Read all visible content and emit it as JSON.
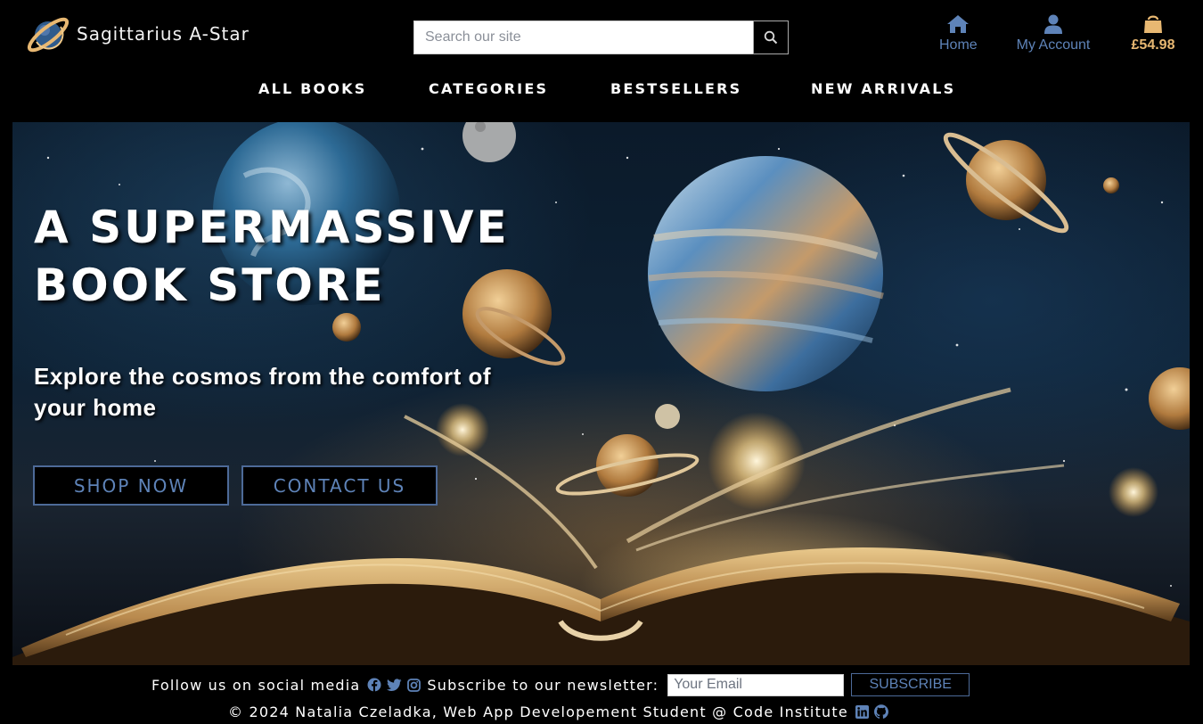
{
  "brand": {
    "name": "Sagittarius A-Star",
    "logo_icon": "planet-logo-icon"
  },
  "search": {
    "placeholder": "Search our site",
    "icon": "search-icon"
  },
  "top_nav": {
    "home": {
      "label": "Home",
      "icon": "home-icon"
    },
    "account": {
      "label": "My Account",
      "icon": "user-icon"
    },
    "bag": {
      "label": "£54.98",
      "icon": "shopping-bag-icon"
    }
  },
  "main_nav": [
    {
      "label": "ALL BOOKS"
    },
    {
      "label": "CATEGORIES"
    },
    {
      "label": "BESTSELLERS"
    },
    {
      "label": "NEW ARRIVALS"
    }
  ],
  "hero": {
    "title_line1": "A SUPERMASSIVE",
    "title_line2": "BOOK STORE",
    "subtitle": "Explore the cosmos from the comfort of your home",
    "shop_button": "SHOP NOW",
    "contact_button": "CONTACT US"
  },
  "footer": {
    "follow_text": "Follow us on social media",
    "social_icons": [
      "facebook-icon",
      "twitter-icon",
      "instagram-icon"
    ],
    "newsletter_text": "Subscribe to our newsletter:",
    "email_placeholder": "Your Email",
    "subscribe_label": "SUBSCRIBE",
    "copyright": "© 2024 Natalia Czeladka, Web App Developement Student @ Code Institute",
    "credit_icons": [
      "linkedin-icon",
      "github-icon"
    ]
  },
  "colors": {
    "accent_blue": "#5e83b8",
    "button_border": "#4d6a98",
    "bag_gold": "#e8b872",
    "background": "#000000"
  }
}
